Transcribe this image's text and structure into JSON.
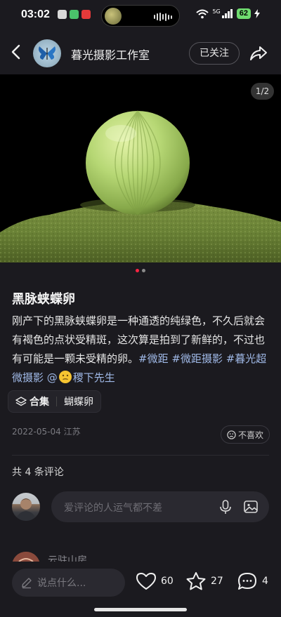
{
  "status": {
    "time": "03:02",
    "battery": "62",
    "signal": "5G"
  },
  "header": {
    "title": "暮光摄影工作室",
    "follow_label": "已关注"
  },
  "photo": {
    "counter": "1/2",
    "page_index": 1,
    "page_total": 2
  },
  "post": {
    "title": "黑脉蛱蝶卵",
    "body_text": "刚产下的黑脉蛱蝶卵是一种通透的纯绿色，不久后就会有褐色的点状受精斑，这次算是拍到了新鲜的，不过也有可能是一颗未受精的卵。",
    "tags": [
      "#微距",
      "#微距摄影",
      "#暮光超微摄影"
    ],
    "mention": "@",
    "mention_name": "稷下先生",
    "collection_label": "合集",
    "collection_name": "蝴蝶卵",
    "date": "2022-05-04",
    "location": "江苏",
    "dislike_label": "不喜欢"
  },
  "comments": {
    "count_label": "共 4 条评论",
    "input_placeholder": "爱评论的人运气都不差",
    "peek_name": "云驻山房"
  },
  "bottom_bar": {
    "say_placeholder": "说点什么...",
    "likes": "60",
    "favorites": "27",
    "comments": "4"
  },
  "colors": {
    "background": "#1b1a1f",
    "accent_dot": "#ff2442",
    "tag_link": "#9fb8e6",
    "battery": "#6fdc6f"
  }
}
